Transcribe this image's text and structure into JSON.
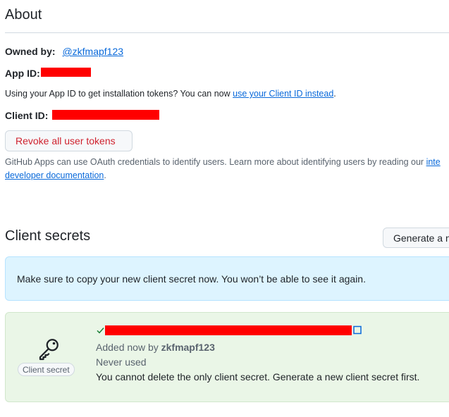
{
  "about": {
    "title": "About",
    "owned_by_label": "Owned by:",
    "owner_link": "@zkfmapf123",
    "app_id_label": "App ID:",
    "client_id_notice_text": "Using your App ID to get installation tokens? You can now ",
    "client_id_notice_link": "use your Client ID instead",
    "client_id_notice_end": ".",
    "client_id_label": "Client ID:",
    "revoke_button": "Revoke all user tokens",
    "oauth_text": "GitHub Apps can use OAuth credentials to identify users. Learn more about identifying users by reading our ",
    "oauth_link_part1": "inte",
    "oauth_link_part2": "developer documentation",
    "oauth_end": "."
  },
  "client_secrets": {
    "title": "Client secrets",
    "generate_button": "Generate a ne",
    "flash_message": "Make sure to copy your new client secret now. You won’t be able to see it again.",
    "secret_label": "Client secret",
    "added_text": "Added now by ",
    "added_by": "zkfmapf123",
    "usage": "Never used",
    "delete_notice": "You cannot delete the only client secret. Generate a new client secret first."
  },
  "colors": {
    "link": "#0969da",
    "danger": "#cf222e",
    "success": "#1a7f37",
    "redaction": "#ff0000"
  }
}
